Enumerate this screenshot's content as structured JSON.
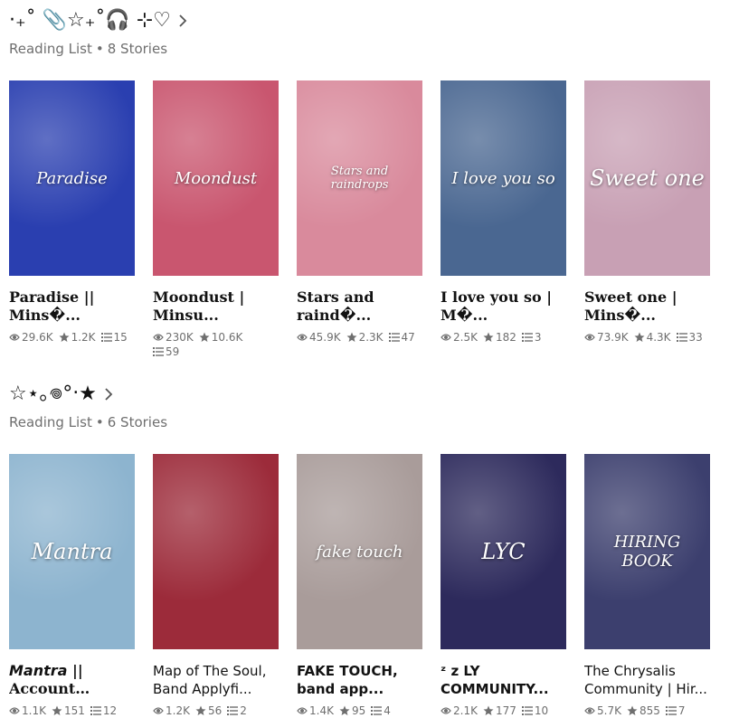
{
  "lists": [
    {
      "title": "·₊˚ 📎☆₊˚🎧 ⊹♡",
      "meta_label": "Reading List",
      "meta_count": "8 Stories",
      "stories": [
        {
          "cover_text": "Paradise",
          "cover_bg": "#2a3fb0",
          "title": "Paradise || Mins�...",
          "reads": "29.6K",
          "votes": "1.2K",
          "parts": "15"
        },
        {
          "cover_text": "Moondust",
          "cover_bg": "#c9566f",
          "title": "Moondust | Minsu...",
          "reads": "230K",
          "votes": "10.6K",
          "parts": "59"
        },
        {
          "cover_text": "Stars and raindrops",
          "cover_bg": "#d98a9c",
          "title": "Stars and raind�...",
          "reads": "45.9K",
          "votes": "2.3K",
          "parts": "47"
        },
        {
          "cover_text": "I love you so",
          "cover_bg": "#4a6791",
          "title": "I love you so | M�...",
          "reads": "2.5K",
          "votes": "182",
          "parts": "3"
        },
        {
          "cover_text": "Sweet one",
          "cover_bg": "#c8a0b4",
          "title": "Sweet one | Mins�...",
          "reads": "73.9K",
          "votes": "4.3K",
          "parts": "33"
        }
      ]
    },
    {
      "title": "☆⋆｡𖦹°‧★",
      "meta_label": "Reading List",
      "meta_count": "6 Stories",
      "stories": [
        {
          "cover_text": "Mantra",
          "cover_bg": "#8db4cf",
          "title": "𝙈𝙖𝙣𝙩𝙧𝙖 || Account ratin...",
          "reads": "1.1K",
          "votes": "151",
          "parts": "12"
        },
        {
          "cover_text": "",
          "cover_bg": "#9c2b3a",
          "title": "Map of The Soul, Band Applyfi...",
          "reads": "1.2K",
          "votes": "56",
          "parts": "2"
        },
        {
          "cover_text": "fake touch",
          "cover_bg": "#a99c9a",
          "title": "FAKE TOUCH, band app...",
          "reads": "1.4K",
          "votes": "95",
          "parts": "4"
        },
        {
          "cover_text": "LYC",
          "cover_bg": "#2d2a5c",
          "title": "ᶻ z LY COMMUNITY...",
          "reads": "2.1K",
          "votes": "177",
          "parts": "10"
        },
        {
          "cover_text": "HIRING BOOK",
          "cover_bg": "#3c3f6e",
          "title": "The Chrysalis Community | Hir...",
          "reads": "5.7K",
          "votes": "855",
          "parts": "7"
        }
      ]
    }
  ]
}
